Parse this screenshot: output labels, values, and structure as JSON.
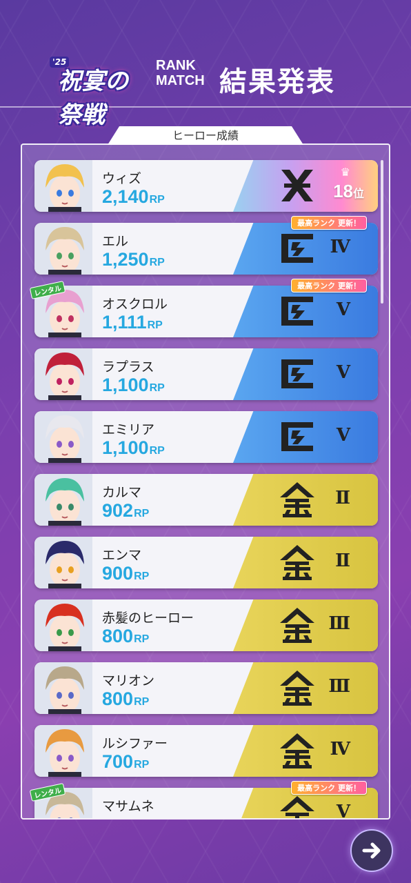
{
  "header": {
    "logo_year": "'25",
    "logo_text": "祝宴の祭戦",
    "rank_match_line1": "RANK",
    "rank_match_line2": "MATCH",
    "title": "結果発表"
  },
  "panel": {
    "tab_label": "ヒーロー成績",
    "best_rank_badge": "最高ランク 更新！",
    "rental_label": "レンタル",
    "rp_unit": "RP",
    "rank_suffix": "位"
  },
  "heroes": [
    {
      "name": "ウィズ",
      "rp": "2,140",
      "rank_style": "top",
      "emblem": "x-emblem-icon",
      "tier": "",
      "position": "18",
      "best": false,
      "rental": false,
      "hair": "#f2c14e",
      "eye": "#3a7be0"
    },
    {
      "name": "エル",
      "rp": "1,250",
      "rank_style": "blue",
      "emblem": "master-emblem-icon",
      "tier": "Ⅳ",
      "position": "",
      "best": true,
      "rental": false,
      "hair": "#d8c49a",
      "eye": "#4aa060"
    },
    {
      "name": "オスクロル",
      "rp": "1,111",
      "rank_style": "blue",
      "emblem": "master-emblem-icon",
      "tier": "Ⅴ",
      "position": "",
      "best": true,
      "rental": true,
      "hair": "#e8a0d0",
      "eye": "#c03060"
    },
    {
      "name": "ラプラス",
      "rp": "1,100",
      "rank_style": "blue",
      "emblem": "master-emblem-icon",
      "tier": "Ⅴ",
      "position": "",
      "best": false,
      "rental": false,
      "hair": "#c0203a",
      "eye": "#c02060"
    },
    {
      "name": "エミリア",
      "rp": "1,100",
      "rank_style": "blue",
      "emblem": "master-emblem-icon",
      "tier": "Ⅴ",
      "position": "",
      "best": false,
      "rental": false,
      "hair": "#e8e8ee",
      "eye": "#8a5ac8"
    },
    {
      "name": "カルマ",
      "rp": "902",
      "rank_style": "gold",
      "emblem": "gold-emblem-icon",
      "tier": "Ⅱ",
      "position": "",
      "best": false,
      "rental": false,
      "hair": "#4ac0a0",
      "eye": "#3a8a6a"
    },
    {
      "name": "エンマ",
      "rp": "900",
      "rank_style": "gold",
      "emblem": "gold-emblem-icon",
      "tier": "Ⅱ",
      "position": "",
      "best": false,
      "rental": false,
      "hair": "#2a2a6a",
      "eye": "#e8a020"
    },
    {
      "name": "赤髪のヒーロー",
      "rp": "800",
      "rank_style": "gold",
      "emblem": "gold-emblem-icon",
      "tier": "Ⅲ",
      "position": "",
      "best": false,
      "rental": false,
      "hair": "#d83020",
      "eye": "#3a9a4a"
    },
    {
      "name": "マリオン",
      "rp": "800",
      "rank_style": "gold",
      "emblem": "gold-emblem-icon",
      "tier": "Ⅲ",
      "position": "",
      "best": false,
      "rental": false,
      "hair": "#b8a88a",
      "eye": "#5a6ac8"
    },
    {
      "name": "ルシファー",
      "rp": "700",
      "rank_style": "gold",
      "emblem": "gold-emblem-icon",
      "tier": "Ⅳ",
      "position": "",
      "best": false,
      "rental": false,
      "hair": "#e89a40",
      "eye": "#8a5ac8"
    },
    {
      "name": "マサムネ",
      "rp": "",
      "rank_style": "gold",
      "emblem": "gold-emblem-icon",
      "tier": "Ⅴ",
      "position": "",
      "best": true,
      "rental": true,
      "hair": "#c8b898",
      "eye": "#5a6ac8"
    }
  ],
  "colors": {
    "rp_text": "#26a8e0",
    "blue_rank": "#3a7be0",
    "gold_rank": "#d8c440"
  }
}
